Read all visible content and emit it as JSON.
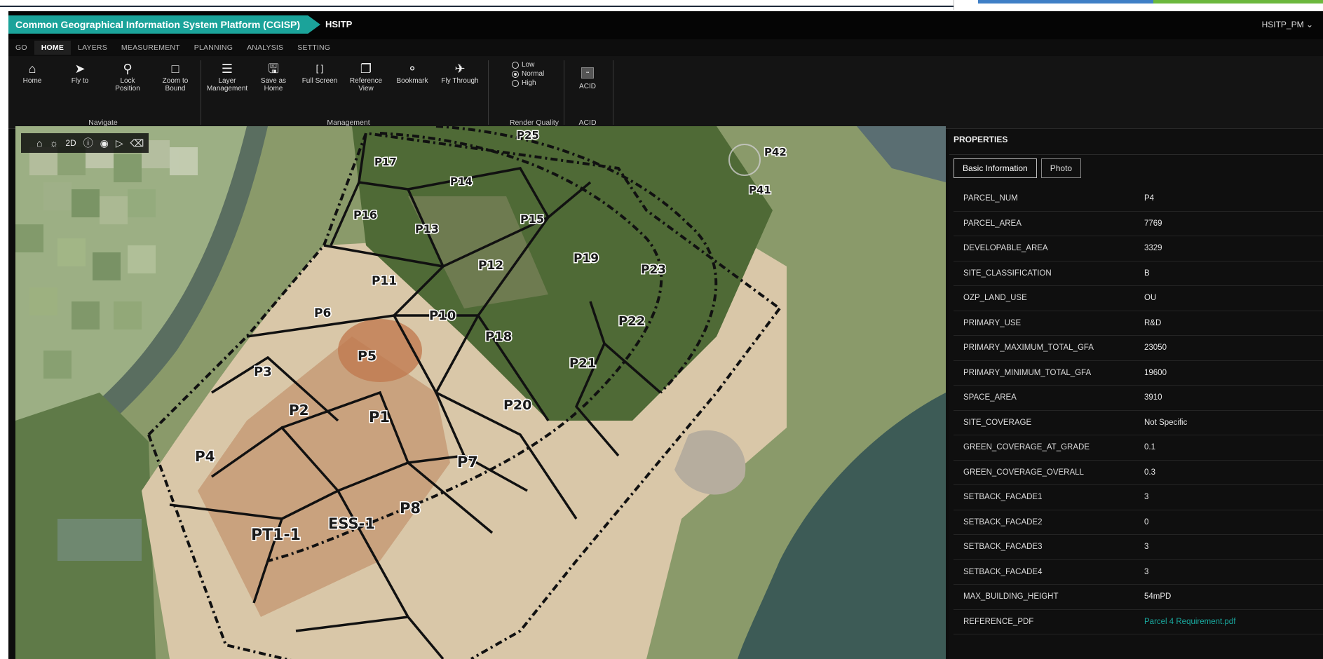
{
  "header": {
    "app_title": "Common Geographical Information System Platform (CGISP)",
    "project": "HSITP",
    "user": "HSITP_PM"
  },
  "menu": [
    "GO",
    "HOME",
    "LAYERS",
    "MEASUREMENT",
    "PLANNING",
    "ANALYSIS",
    "SETTING"
  ],
  "ribbon": {
    "buttons": [
      {
        "label": "Home",
        "icon": "home-icon"
      },
      {
        "label": "Fly to",
        "icon": "send-icon"
      },
      {
        "label": "Lock Position",
        "icon": "lock-icon"
      },
      {
        "label": "Zoom to Bound",
        "icon": "zoom-bound-icon"
      },
      {
        "label": "Layer Management",
        "icon": "list-icon"
      },
      {
        "label": "Save as Home",
        "icon": "save-icon"
      },
      {
        "label": "Full Screen",
        "icon": "fullscreen-icon"
      },
      {
        "label": "Reference View",
        "icon": "copy-icon"
      },
      {
        "label": "Bookmark",
        "icon": "tag-icon"
      },
      {
        "label": "Fly Through",
        "icon": "plane-icon"
      }
    ],
    "groups": {
      "navigate": "Navigate",
      "management": "Management",
      "render_quality": "Render Quality",
      "acid": "ACID"
    },
    "render_quality": {
      "options": [
        "Low",
        "Normal",
        "High"
      ],
      "selected": "Normal"
    },
    "acid": {
      "label": "ACID"
    }
  },
  "map_toolbar": {
    "mode_label": "2D"
  },
  "parcels": [
    "P25",
    "P17",
    "P14",
    "P42",
    "P41",
    "P16",
    "P13",
    "P15",
    "P12",
    "P19",
    "P23",
    "P11",
    "P6",
    "P10",
    "P18",
    "P22",
    "P5",
    "P3",
    "P21",
    "P2",
    "P1",
    "P20",
    "P4",
    "P7",
    "P8",
    "ESS-1",
    "PT1-1"
  ],
  "properties": {
    "title": "PROPERTIES",
    "tabs": [
      "Basic Information",
      "Photo"
    ],
    "rows": [
      {
        "key": "PARCEL_NUM",
        "value": "P4"
      },
      {
        "key": "PARCEL_AREA",
        "value": "7769"
      },
      {
        "key": "DEVELOPABLE_AREA",
        "value": "3329"
      },
      {
        "key": "SITE_CLASSIFICATION",
        "value": "B"
      },
      {
        "key": "OZP_LAND_USE",
        "value": "OU"
      },
      {
        "key": "PRIMARY_USE",
        "value": "R&D"
      },
      {
        "key": "PRIMARY_MAXIMUM_TOTAL_GFA",
        "value": "23050"
      },
      {
        "key": "PRIMARY_MINIMUM_TOTAL_GFA",
        "value": "19600"
      },
      {
        "key": "SPACE_AREA",
        "value": "3910"
      },
      {
        "key": "SITE_COVERAGE",
        "value": "Not Specific"
      },
      {
        "key": "GREEN_COVERAGE_AT_GRADE",
        "value": "0.1"
      },
      {
        "key": "GREEN_COVERAGE_OVERALL",
        "value": "0.3"
      },
      {
        "key": "SETBACK_FACADE1",
        "value": "3"
      },
      {
        "key": "SETBACK_FACADE2",
        "value": "0"
      },
      {
        "key": "SETBACK_FACADE3",
        "value": "3"
      },
      {
        "key": "SETBACK_FACADE4",
        "value": "3"
      },
      {
        "key": "MAX_BUILDING_HEIGHT",
        "value": "54mPD"
      },
      {
        "key": "REFERENCE_PDF",
        "value": "Parcel 4 Requirement.pdf",
        "link": true
      }
    ]
  },
  "colors": {
    "brand": "#1ba39a",
    "link": "#19a89e"
  }
}
